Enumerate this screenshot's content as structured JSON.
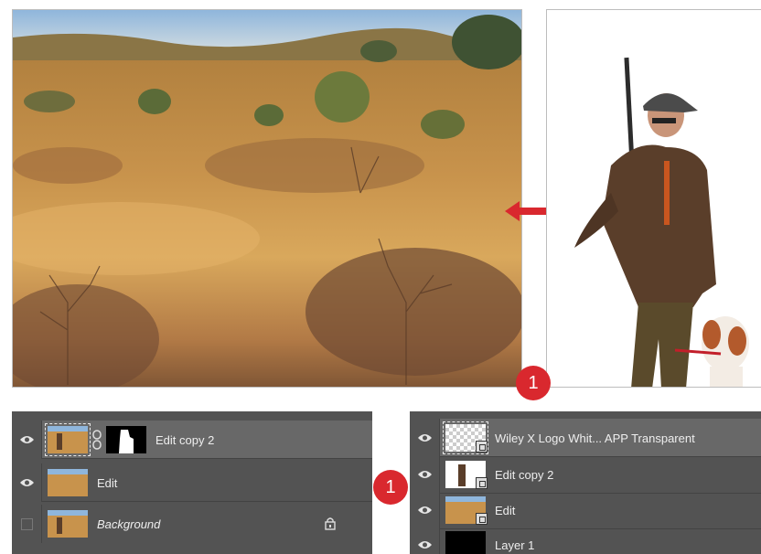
{
  "badges": {
    "first": "1",
    "second": "1"
  },
  "colors": {
    "accent": "#d9282e",
    "panel_bg": "#535353",
    "selected_row": "#686868"
  },
  "left_panel": {
    "layers": [
      {
        "name": "Edit copy 2",
        "visible": true,
        "selected": true,
        "has_mask": true,
        "icon": "eye-icon"
      },
      {
        "name": "Edit",
        "visible": true,
        "selected": false,
        "icon": "eye-icon"
      },
      {
        "name": "Background",
        "visible": false,
        "selected": false,
        "locked": true,
        "icon": "lock-icon"
      }
    ]
  },
  "right_panel": {
    "layers": [
      {
        "name": "Wiley X Logo Whit... APP Transparent",
        "visible": true,
        "selected": true,
        "smart_object": true
      },
      {
        "name": "Edit copy 2",
        "visible": true,
        "selected": false,
        "smart_object": true
      },
      {
        "name": "Edit",
        "visible": true,
        "selected": false,
        "smart_object": true
      },
      {
        "name": "Layer 1",
        "visible": true,
        "selected": false
      }
    ]
  }
}
